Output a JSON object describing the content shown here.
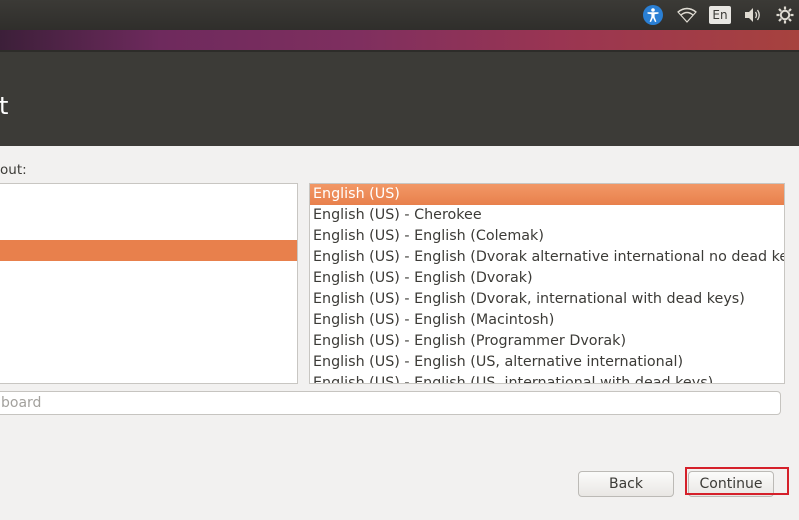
{
  "tray": {
    "accessibility_icon": "accessibility-icon",
    "wifi_icon": "wifi-icon",
    "keyboard_indicator": "En",
    "volume_icon": "volume-icon",
    "settings_icon": "gear-icon"
  },
  "header": {
    "title": "t"
  },
  "main": {
    "prompt": "out:",
    "layouts": [],
    "variants": [
      "English (US)",
      "English (US) - Cherokee",
      "English (US) - English (Colemak)",
      "English (US) - English (Dvorak alternative international no dead keys)",
      "English (US) - English (Dvorak)",
      "English (US) - English (Dvorak, international with dead keys)",
      "English (US) - English (Macintosh)",
      "English (US) - English (Programmer Dvorak)",
      "English (US) - English (US, alternative international)",
      "English (US) - English (US, international with dead keys)"
    ],
    "selected_variant_index": 0,
    "test_placeholder": "board"
  },
  "footer": {
    "back_label": "Back",
    "continue_label": "Continue"
  },
  "colors": {
    "selection": "#e8804c",
    "highlight_box": "#d5202a",
    "header_bg": "#3c3b37"
  }
}
